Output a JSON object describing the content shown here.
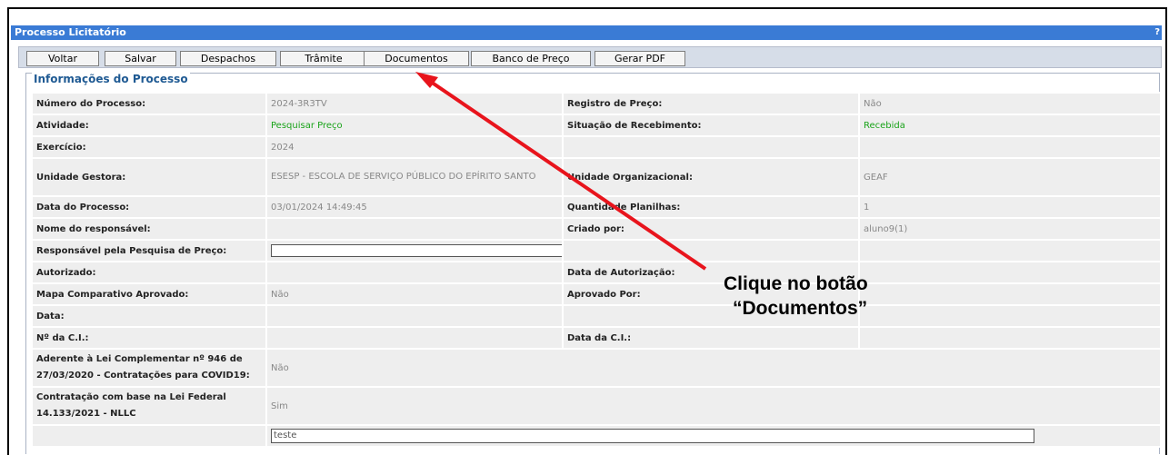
{
  "window": {
    "title": "Processo Licitatório",
    "help": "?"
  },
  "toolbar": {
    "buttons": [
      "Voltar",
      "Salvar",
      "Despachos",
      "Trâmite",
      "Documentos",
      "Banco de Preço",
      "Gerar PDF"
    ]
  },
  "section": {
    "legend": "Informações do Processo"
  },
  "rows": [
    {
      "l1": "Número do Processo:",
      "v1": "2024-3R3TV",
      "l2": "Registro de Preço:",
      "v2": "Não"
    },
    {
      "l1": "Atividade:",
      "v1": "Pesquisar Preço",
      "l2": "Situação de Recebimento:",
      "v2": "Recebida"
    },
    {
      "l1": "Exercício:",
      "v1": "2024",
      "l2": "",
      "v2": ""
    },
    {
      "l1": "Unidade Gestora:",
      "v1": "ESESP - ESCOLA DE SERVIÇO PÚBLICO DO EPÍRITO SANTO",
      "l2": "Unidade Organizacional:",
      "v2": "GEAF"
    },
    {
      "l1": "Data do Processo:",
      "v1": "03/01/2024 14:49:45",
      "l2": "Quantidade Planilhas:",
      "v2": "1"
    },
    {
      "l1": "Nome do responsável:",
      "v1": "",
      "l2": "Criado por:",
      "v2": "aluno9(1)"
    },
    {
      "l1": "Responsável pela Pesquisa de Preço:",
      "v1": "",
      "l2": "",
      "v2": ""
    },
    {
      "l1": "Autorizado:",
      "v1": "",
      "l2": "Data de Autorização:",
      "v2": ""
    },
    {
      "l1": "Mapa Comparativo Aprovado:",
      "v1": "Não",
      "l2": "Aprovado Por:",
      "v2": ""
    },
    {
      "l1": "Data:",
      "v1": "",
      "l2": "",
      "v2": ""
    },
    {
      "l1": "Nº da C.I.:",
      "v1": "",
      "l2": "Data da C.I.:",
      "v2": ""
    },
    {
      "l1": "Aderente à Lei Complementar nº 946 de 27/03/2020 - Contratações para COVID19:",
      "v1": "Não"
    },
    {
      "l1": "Contratação com base na Lei Federal 14.133/2021 - NLLC",
      "v1": "Sim"
    },
    {
      "l1": "",
      "v1": "teste"
    }
  ],
  "annotation": {
    "line1": "Clique no botão",
    "line2": "“Documentos”",
    "arrow_color": "#e8141c"
  },
  "colors": {
    "titlebar": "#3a7bd5",
    "toolbar": "#d6dde8",
    "legend": "#1f5a93",
    "green_value": "#1aa31a"
  }
}
